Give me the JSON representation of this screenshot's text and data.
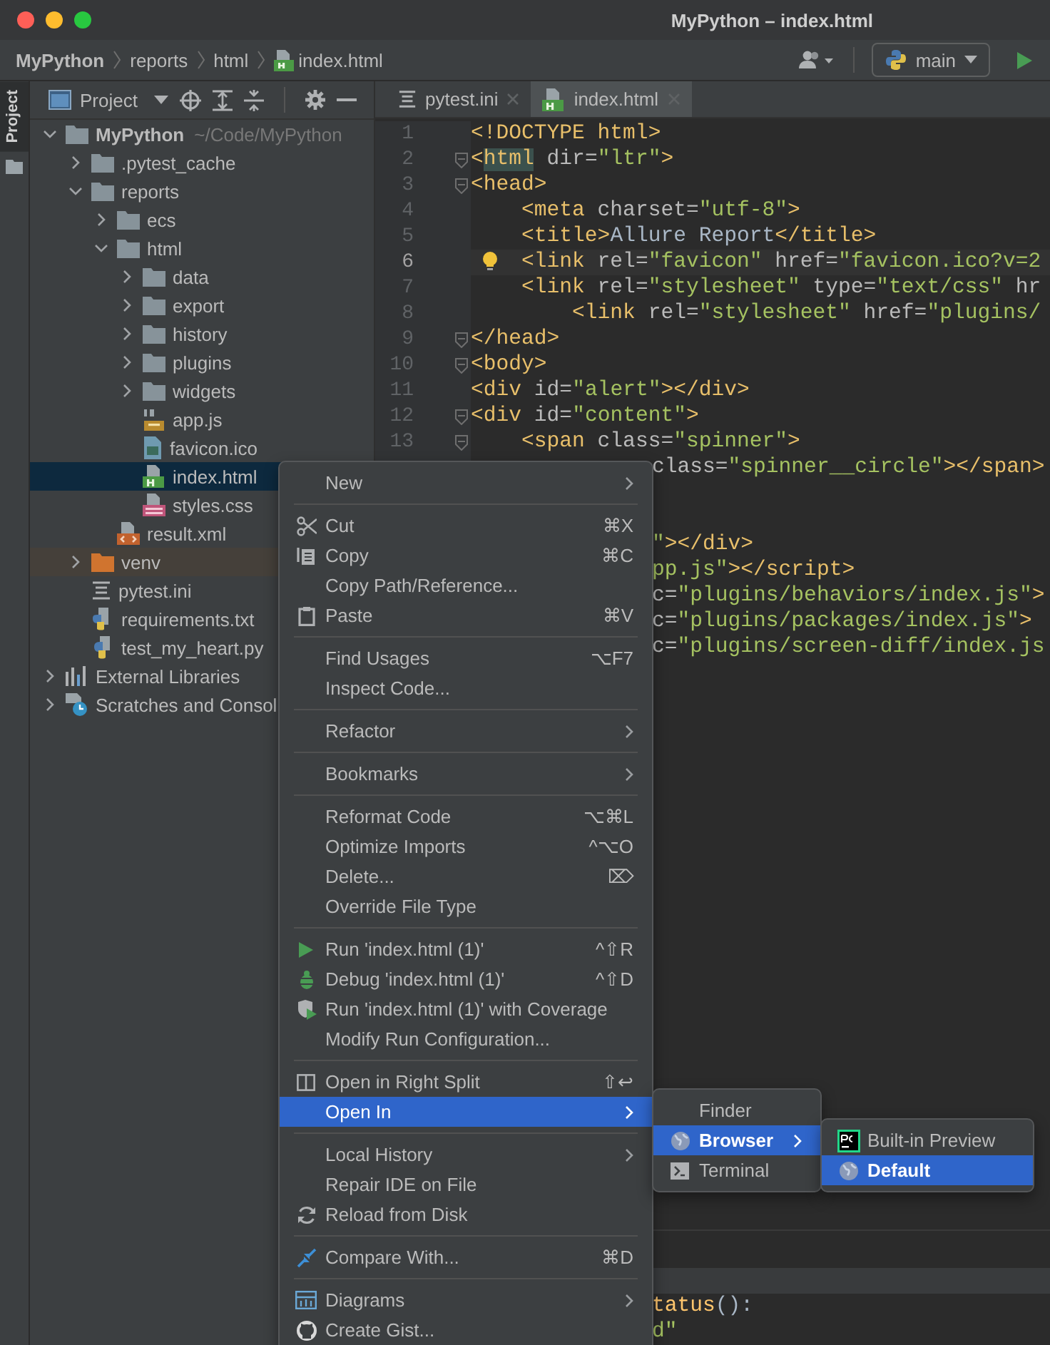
{
  "window": {
    "title": "MyPython – index.html"
  },
  "breadcrumbs": [
    {
      "label": "MyPython",
      "kind": "project"
    },
    {
      "label": "reports",
      "kind": "folder"
    },
    {
      "label": "html",
      "kind": "folder"
    },
    {
      "label": "index.html",
      "kind": "html"
    }
  ],
  "branch": {
    "label": "main"
  },
  "side_stripe": {
    "label": "Project",
    "selected": true
  },
  "project_panel": {
    "title": "Project"
  },
  "project_tree": [
    {
      "label": "MyPython",
      "hint": "~/Code/MyPython",
      "kind": "folder",
      "expanded": true,
      "selected": false,
      "children": [
        {
          "label": ".pytest_cache",
          "kind": "folder",
          "expanded": false,
          "selected": false
        },
        {
          "label": "reports",
          "kind": "folder",
          "expanded": true,
          "selected": false,
          "children": [
            {
              "label": "ecs",
              "kind": "folder",
              "expanded": false,
              "selected": false
            },
            {
              "label": "html",
              "kind": "folder",
              "expanded": true,
              "selected": false,
              "children": [
                {
                  "label": "data",
                  "kind": "folder",
                  "expanded": false,
                  "selected": false
                },
                {
                  "label": "export",
                  "kind": "folder",
                  "expanded": false,
                  "selected": false
                },
                {
                  "label": "history",
                  "kind": "folder",
                  "expanded": false,
                  "selected": false
                },
                {
                  "label": "plugins",
                  "kind": "folder",
                  "expanded": false,
                  "selected": false
                },
                {
                  "label": "widgets",
                  "kind": "folder",
                  "expanded": false,
                  "selected": false
                },
                {
                  "label": "app.js",
                  "kind": "js",
                  "selected": false
                },
                {
                  "label": "favicon.ico",
                  "kind": "ico",
                  "selected": false
                },
                {
                  "label": "index.html",
                  "kind": "html",
                  "selected": true
                },
                {
                  "label": "styles.css",
                  "kind": "css",
                  "selected": false
                }
              ]
            },
            {
              "label": "result.xml",
              "kind": "xml",
              "selected": false
            }
          ]
        },
        {
          "label": "venv",
          "kind": "excluded-folder",
          "expanded": false,
          "selected": false
        },
        {
          "label": "pytest.ini",
          "kind": "ini",
          "selected": false
        },
        {
          "label": "requirements.txt",
          "kind": "txt",
          "selected": false
        },
        {
          "label": "test_my_heart.py",
          "kind": "py",
          "selected": false
        }
      ]
    },
    {
      "label": "External Libraries",
      "kind": "libraries",
      "expanded": false,
      "selected": false
    },
    {
      "label": "Scratches and Consol",
      "kind": "scratches",
      "expanded": false,
      "selected": false
    }
  ],
  "editor_tabs": [
    {
      "label": "pytest.ini",
      "kind": "ini",
      "selected": false
    },
    {
      "label": "index.html",
      "kind": "html",
      "selected": true
    }
  ],
  "code_lines": [
    {
      "number": "1",
      "fold": false,
      "current": false,
      "intention": false,
      "tokens": [
        {
          "kind": "tag",
          "text": "<!DOCTYPE html>"
        }
      ]
    },
    {
      "number": "2",
      "fold": true,
      "current": false,
      "intention": false,
      "tokens": [
        {
          "kind": "tag",
          "text": "<"
        },
        {
          "kind": "match",
          "text": "html"
        },
        {
          "kind": "attr",
          "text": " dir="
        },
        {
          "kind": "str",
          "text": "\"ltr\""
        },
        {
          "kind": "tag",
          "text": ">"
        }
      ]
    },
    {
      "number": "3",
      "fold": true,
      "current": false,
      "intention": false,
      "tokens": [
        {
          "kind": "tag",
          "text": "<head>"
        }
      ]
    },
    {
      "number": "4",
      "fold": false,
      "current": false,
      "intention": false,
      "tokens": [
        {
          "kind": "tag",
          "text": "    <meta"
        },
        {
          "kind": "attr",
          "text": " charset="
        },
        {
          "kind": "str",
          "text": "\"utf-8\""
        },
        {
          "kind": "tag",
          "text": ">"
        }
      ]
    },
    {
      "number": "5",
      "fold": false,
      "current": false,
      "intention": false,
      "tokens": [
        {
          "kind": "tag",
          "text": "    <title>"
        },
        {
          "kind": "text",
          "text": "Allure Report"
        },
        {
          "kind": "tag",
          "text": "</title>"
        }
      ]
    },
    {
      "number": "6",
      "fold": false,
      "current": true,
      "intention": true,
      "tokens": [
        {
          "kind": "tag",
          "text": "    <link"
        },
        {
          "kind": "attr",
          "text": " rel="
        },
        {
          "kind": "str",
          "text": "\"favicon\""
        },
        {
          "kind": "attr",
          "text": " href="
        },
        {
          "kind": "str",
          "text": "\"favicon.ico?v=2"
        }
      ]
    },
    {
      "number": "7",
      "fold": false,
      "current": false,
      "intention": false,
      "tokens": [
        {
          "kind": "tag",
          "text": "    <link"
        },
        {
          "kind": "attr",
          "text": " rel="
        },
        {
          "kind": "str",
          "text": "\"stylesheet\""
        },
        {
          "kind": "attr",
          "text": " type="
        },
        {
          "kind": "str",
          "text": "\"text/css\""
        },
        {
          "kind": "attr",
          "text": " hr"
        }
      ]
    },
    {
      "number": "8",
      "fold": false,
      "current": false,
      "intention": false,
      "tokens": [
        {
          "kind": "tag",
          "text": "        <link"
        },
        {
          "kind": "attr",
          "text": " rel="
        },
        {
          "kind": "str",
          "text": "\"stylesheet\""
        },
        {
          "kind": "attr",
          "text": " href="
        },
        {
          "kind": "str",
          "text": "\"plugins/"
        }
      ]
    },
    {
      "number": "9",
      "fold": true,
      "current": false,
      "intention": false,
      "tokens": [
        {
          "kind": "tag",
          "text": "</head>"
        }
      ]
    },
    {
      "number": "10",
      "fold": true,
      "current": false,
      "intention": false,
      "tokens": [
        {
          "kind": "tag",
          "text": "<body>"
        }
      ]
    },
    {
      "number": "11",
      "fold": false,
      "current": false,
      "intention": false,
      "tokens": [
        {
          "kind": "tag",
          "text": "<div"
        },
        {
          "kind": "attr",
          "text": " id="
        },
        {
          "kind": "str",
          "text": "\"alert\""
        },
        {
          "kind": "tag",
          "text": "></div>"
        }
      ]
    },
    {
      "number": "12",
      "fold": true,
      "current": false,
      "intention": false,
      "tokens": [
        {
          "kind": "tag",
          "text": "<div"
        },
        {
          "kind": "attr",
          "text": " id="
        },
        {
          "kind": "str",
          "text": "\"content\""
        },
        {
          "kind": "tag",
          "text": ">"
        }
      ]
    },
    {
      "number": "13",
      "fold": true,
      "current": false,
      "intention": false,
      "tokens": [
        {
          "kind": "tag",
          "text": "    <span"
        },
        {
          "kind": "attr",
          "text": " class="
        },
        {
          "kind": "str",
          "text": "\"spinner\""
        },
        {
          "kind": "tag",
          "text": ">"
        }
      ]
    }
  ],
  "covered_lines": [
    {
      "kind": "partial",
      "tokens": [
        {
          "kind": "attr",
          "text": "class="
        },
        {
          "kind": "str",
          "text": "\"spinner__circle\""
        },
        {
          "kind": "tag",
          "text": "></span>"
        }
      ]
    },
    {
      "kind": "blank"
    },
    {
      "kind": "blank"
    },
    {
      "kind": "partial",
      "tokens": [
        {
          "kind": "str",
          "text": "\""
        },
        {
          "kind": "tag",
          "text": "></div>"
        }
      ]
    },
    {
      "kind": "partial",
      "tokens": [
        {
          "kind": "str",
          "text": "pp.js\""
        },
        {
          "kind": "tag",
          "text": "></script>"
        }
      ]
    },
    {
      "kind": "partial",
      "tokens": [
        {
          "kind": "attr",
          "text": "c="
        },
        {
          "kind": "str",
          "text": "\"plugins/behaviors/index.js\""
        },
        {
          "kind": "tag",
          "text": ">"
        }
      ]
    },
    {
      "kind": "partial",
      "tokens": [
        {
          "kind": "attr",
          "text": "c="
        },
        {
          "kind": "str",
          "text": "\"plugins/packages/index.js\""
        },
        {
          "kind": "tag",
          "text": ">"
        }
      ]
    },
    {
      "kind": "partial",
      "tokens": [
        {
          "kind": "attr",
          "text": "c="
        },
        {
          "kind": "str",
          "text": "\"plugins/screen-diff/index.js"
        }
      ]
    }
  ],
  "lower_pane_lines": [
    {
      "tokens": [
        {
          "kind": "func",
          "text": "tatus"
        },
        {
          "kind": "text",
          "text": "():"
        }
      ]
    },
    {
      "tokens": [
        {
          "kind": "str",
          "text": "d\""
        }
      ]
    }
  ],
  "context_menu": [
    {
      "kind": "plain",
      "label": "New",
      "submenu": true,
      "selected": false
    },
    {
      "kind": "separator"
    },
    {
      "kind": "cut",
      "label": "Cut",
      "shortcut": "⌘X",
      "submenu": false,
      "selected": false
    },
    {
      "kind": "copy",
      "label": "Copy",
      "shortcut": "⌘C",
      "submenu": false,
      "selected": false
    },
    {
      "kind": "plain",
      "label": "Copy Path/Reference...",
      "submenu": false,
      "selected": false
    },
    {
      "kind": "paste",
      "label": "Paste",
      "shortcut": "⌘V",
      "submenu": false,
      "selected": false
    },
    {
      "kind": "separator"
    },
    {
      "kind": "plain",
      "label": "Find Usages",
      "shortcut": "⌥F7",
      "submenu": false,
      "selected": false
    },
    {
      "kind": "plain",
      "label": "Inspect Code...",
      "submenu": false,
      "selected": false
    },
    {
      "kind": "separator"
    },
    {
      "kind": "plain",
      "label": "Refactor",
      "submenu": true,
      "selected": false
    },
    {
      "kind": "separator"
    },
    {
      "kind": "plain",
      "label": "Bookmarks",
      "submenu": true,
      "selected": false
    },
    {
      "kind": "separator"
    },
    {
      "kind": "plain",
      "label": "Reformat Code",
      "shortcut": "⌥⌘L",
      "submenu": false,
      "selected": false
    },
    {
      "kind": "plain",
      "label": "Optimize Imports",
      "shortcut": "^⌥O",
      "submenu": false,
      "selected": false
    },
    {
      "kind": "plain",
      "label": "Delete...",
      "shortcut": "⌦",
      "submenu": false,
      "selected": false
    },
    {
      "kind": "plain",
      "label": "Override File Type",
      "submenu": false,
      "selected": false
    },
    {
      "kind": "separator"
    },
    {
      "kind": "run",
      "label": "Run 'index.html (1)'",
      "shortcut": "^⇧R",
      "submenu": false,
      "selected": false
    },
    {
      "kind": "debug",
      "label": "Debug 'index.html (1)'",
      "shortcut": "^⇧D",
      "submenu": false,
      "selected": false
    },
    {
      "kind": "coverage",
      "label": "Run 'index.html (1)' with Coverage",
      "submenu": false,
      "selected": false
    },
    {
      "kind": "plain",
      "label": "Modify Run Configuration...",
      "submenu": false,
      "selected": false
    },
    {
      "kind": "separator"
    },
    {
      "kind": "split",
      "label": "Open in Right Split",
      "shortcut": "⇧↩",
      "submenu": false,
      "selected": false
    },
    {
      "kind": "plain",
      "label": "Open In",
      "submenu": true,
      "selected": true
    },
    {
      "kind": "separator"
    },
    {
      "kind": "plain",
      "label": "Local History",
      "submenu": true,
      "selected": false
    },
    {
      "kind": "plain",
      "label": "Repair IDE on File",
      "submenu": false,
      "selected": false
    },
    {
      "kind": "reload",
      "label": "Reload from Disk",
      "submenu": false,
      "selected": false
    },
    {
      "kind": "separator"
    },
    {
      "kind": "compare",
      "label": "Compare With...",
      "shortcut": "⌘D",
      "submenu": false,
      "selected": false
    },
    {
      "kind": "separator"
    },
    {
      "kind": "diagrams",
      "label": "Diagrams",
      "submenu": true,
      "selected": false
    },
    {
      "kind": "gist",
      "label": "Create Gist...",
      "submenu": false,
      "selected": false
    }
  ],
  "open_in_menu": [
    {
      "kind": "plain",
      "label": "Finder",
      "submenu": false,
      "selected": false
    },
    {
      "kind": "browser",
      "label": "Browser",
      "submenu": true,
      "selected": true
    },
    {
      "kind": "terminal",
      "label": "Terminal",
      "submenu": false,
      "selected": false
    }
  ],
  "browser_menu": [
    {
      "kind": "ide",
      "label": "Built-in Preview",
      "selected": false
    },
    {
      "kind": "browser",
      "label": "Default",
      "selected": true
    }
  ]
}
